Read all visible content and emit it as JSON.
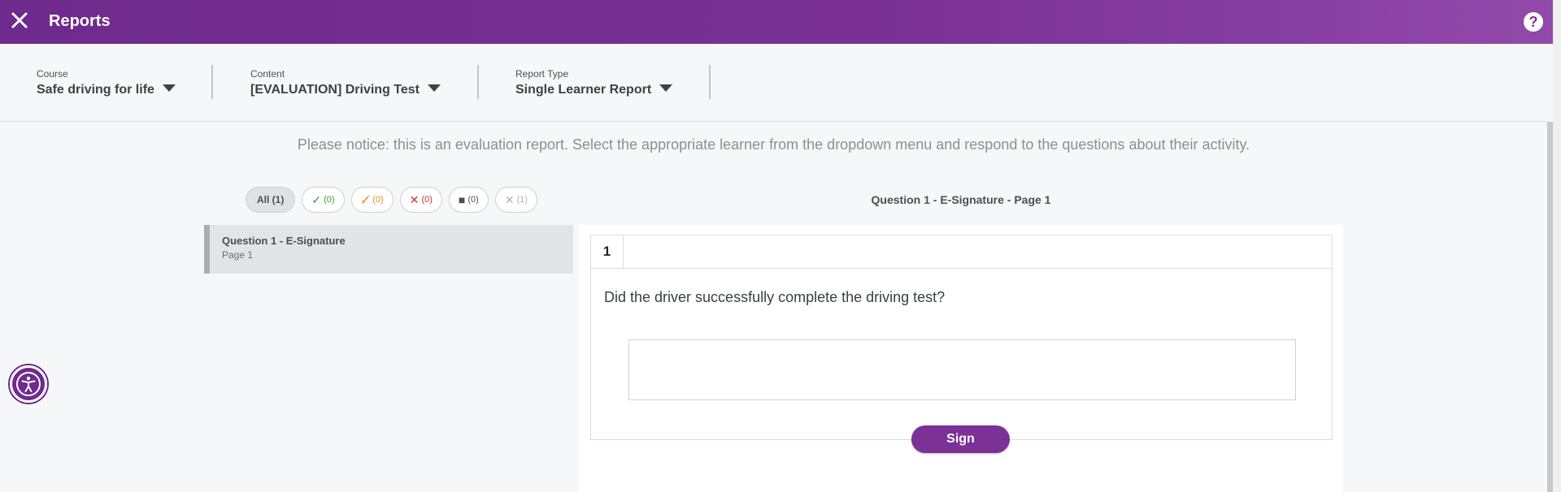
{
  "header": {
    "title": "Reports",
    "help_label": "?"
  },
  "filters": {
    "course": {
      "label": "Course",
      "value": "Safe driving for life"
    },
    "content": {
      "label": "Content",
      "value": "[EVALUATION] Driving Test"
    },
    "report_type": {
      "label": "Report Type",
      "value": "Single Learner Report"
    }
  },
  "notice": "Please notice: this is an evaluation report. Select the appropriate learner from the dropdown menu and respond to the questions about their activity.",
  "chips": {
    "all": "All (1)",
    "correct": "(0)",
    "partial": "(0)",
    "incorrect": "(0)",
    "ungraded": "(0)",
    "skipped": "(1)"
  },
  "question_header": "Question 1 - E-Signature - Page 1",
  "question_list": [
    {
      "title": "Question 1 - E-Signature",
      "subtitle": "Page 1"
    }
  ],
  "question": {
    "number": "1",
    "text": "Did the driver successfully complete the driving test?",
    "sign_label": "Sign"
  },
  "colors": {
    "brand": "#7b3196",
    "correct": "#3a9b2f",
    "partial": "#e08a1e",
    "incorrect": "#d32f2f",
    "ungraded": "#4a4f55",
    "skipped": "#b0b4b8"
  }
}
